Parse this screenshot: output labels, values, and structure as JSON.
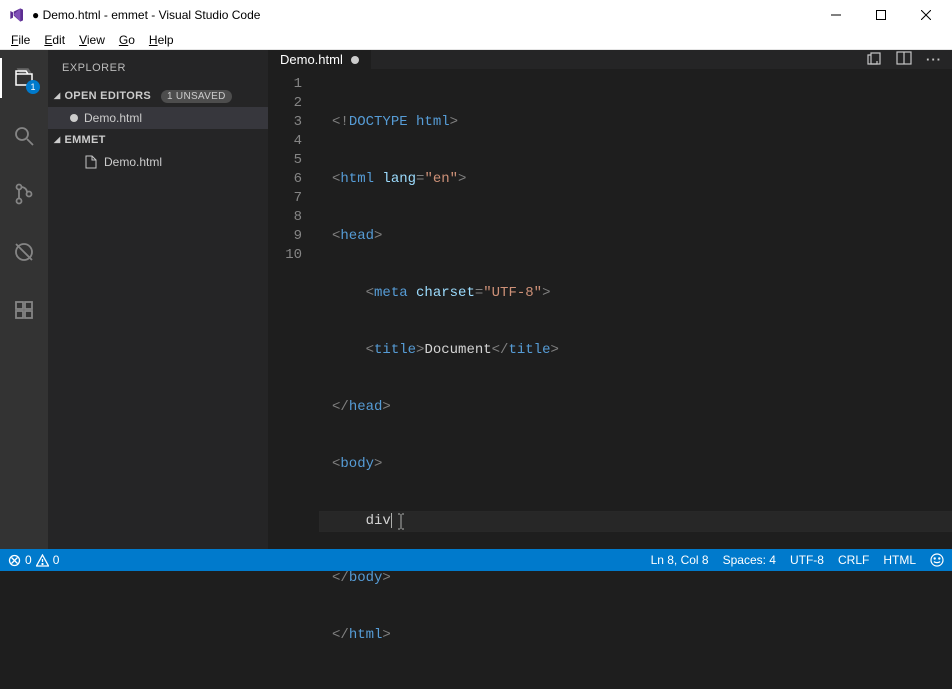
{
  "window": {
    "title": "● Demo.html - emmet - Visual Studio Code"
  },
  "menu": {
    "file": "File",
    "edit": "Edit",
    "view": "View",
    "go": "Go",
    "help": "Help"
  },
  "activitybar": {
    "badge": "1"
  },
  "sidebar": {
    "title": "EXPLORER",
    "open_editors_header": "OPEN EDITORS",
    "unsaved_badge": "1 UNSAVED",
    "open_editor_item": "Demo.html",
    "project_header": "EMMET",
    "project_file": "Demo.html"
  },
  "tabs": {
    "active": "Demo.html"
  },
  "code": {
    "lines": [
      {
        "n": "1"
      },
      {
        "n": "2"
      },
      {
        "n": "3"
      },
      {
        "n": "4"
      },
      {
        "n": "5"
      },
      {
        "n": "6"
      },
      {
        "n": "7"
      },
      {
        "n": "8"
      },
      {
        "n": "9"
      },
      {
        "n": "10"
      }
    ],
    "l1_doctype": "DOCTYPE",
    "l1_html": "html",
    "l2_html": "html",
    "l2_attr": "lang",
    "l2_val": "\"en\"",
    "l3_head": "head",
    "l4_meta": "meta",
    "l4_attr": "charset",
    "l4_val": "\"UTF-8\"",
    "l5_title": "title",
    "l5_text": "Document",
    "l6_head": "head",
    "l7_body": "body",
    "l8_text": "div",
    "l9_body": "body",
    "l10_html": "html"
  },
  "statusbar": {
    "errors": "0",
    "warnings": "0",
    "pos": "Ln 8, Col 8",
    "spaces": "Spaces: 4",
    "encoding": "UTF-8",
    "eol": "CRLF",
    "lang": "HTML"
  }
}
